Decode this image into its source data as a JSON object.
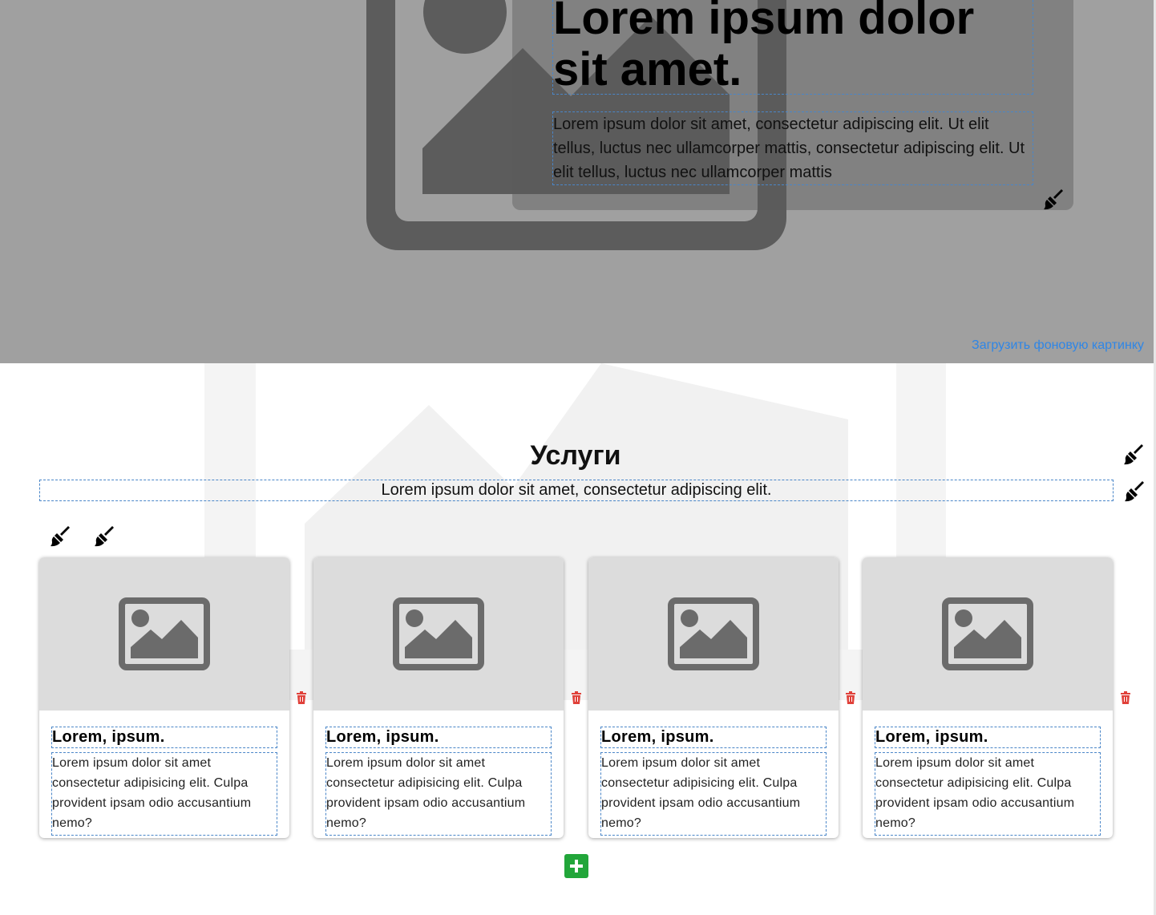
{
  "hero": {
    "title": "Lorem ipsum dolor sit amet.",
    "text": "Lorem ipsum dolor sit amet, consectetur adipiscing elit. Ut elit tellus, luctus nec ullamcorper mattis, consectetur adipiscing elit. Ut elit tellus, luctus nec ullamcorper mattis",
    "upload_link": "Загрузить фоновую картинку",
    "background_color": "#a0a0a0"
  },
  "services": {
    "title": "Услуги",
    "subtitle": "Lorem ipsum dolor sit amet, consectetur adipiscing elit.",
    "cards": [
      {
        "title": "Lorem, ipsum.",
        "text": "Lorem ipsum dolor sit amet consectetur adipisicing elit. Culpa provident ipsam odio accusantium nemo?"
      },
      {
        "title": "Lorem, ipsum.",
        "text": "Lorem ipsum dolor sit amet consectetur adipisicing elit. Culpa provident ipsam odio accusantium nemo?"
      },
      {
        "title": "Lorem, ipsum.",
        "text": "Lorem ipsum dolor sit amet consectetur adipisicing elit. Culpa provident ipsam odio accusantium nemo?"
      },
      {
        "title": "Lorem, ipsum.",
        "text": "Lorem ipsum dolor sit amet consectetur adipisicing elit. Culpa provident ipsam odio accusantium nemo?"
      }
    ]
  },
  "icons": {
    "brush": "paint-brush-icon",
    "trash": "trash-icon",
    "add": "plus-icon",
    "placeholder": "image-placeholder-icon"
  },
  "colors": {
    "accent_link": "#2f86e6",
    "add_button": "#22a63a",
    "delete": "#e0413a",
    "dashed_border": "#4a86c8"
  }
}
